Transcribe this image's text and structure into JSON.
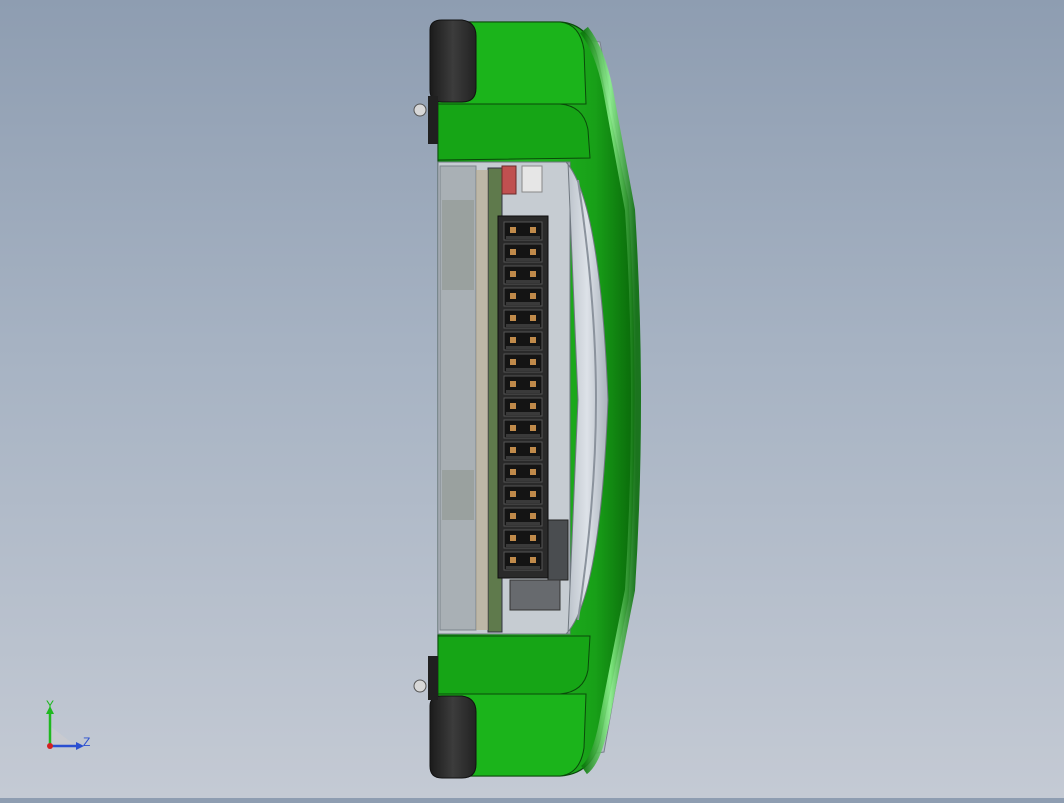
{
  "view": {
    "background_top": "#8e9db1",
    "background_bottom": "#c4cad4"
  },
  "model": {
    "shell_color": "#17a517",
    "shell_highlight": "#7df07d",
    "bumper_color": "#2b2b2b",
    "pcb_color": "#5f7a4c",
    "connector_color": "#1e1e1e",
    "connector_count": 16
  },
  "triad": {
    "y_label": "Y",
    "z_label": "Z",
    "y_color": "#1fb81f",
    "z_color": "#2a4fd1",
    "origin_color": "#d42020"
  }
}
